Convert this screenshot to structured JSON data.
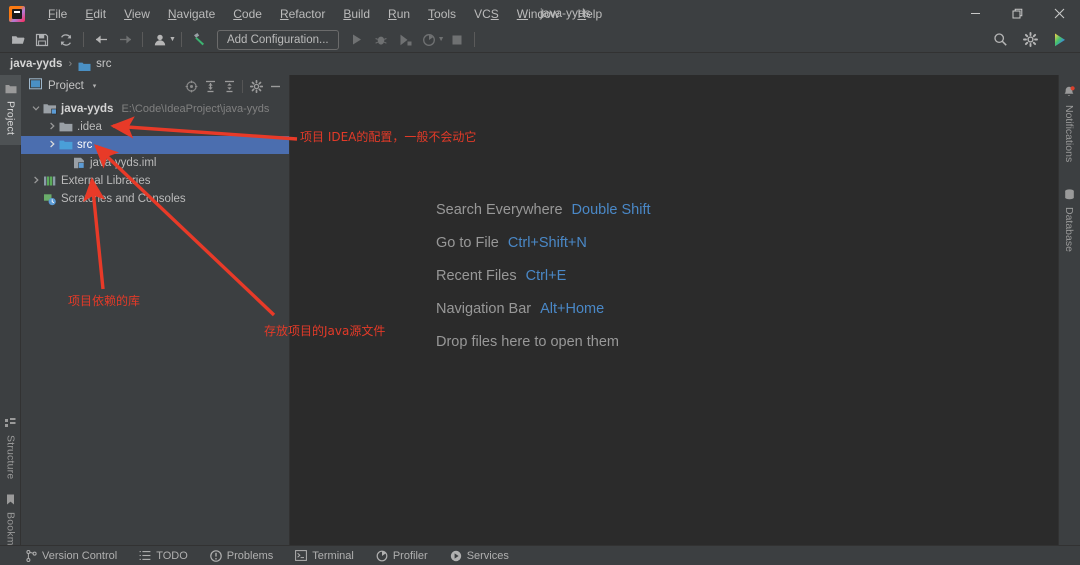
{
  "window": {
    "title": "java-yyds",
    "logo_icon": "intellij-idea-logo",
    "minimize_label": "─",
    "maximize_label": "❐",
    "close_label": "✕"
  },
  "menu": {
    "items": [
      {
        "label": "File",
        "mnemonic": "F"
      },
      {
        "label": "Edit",
        "mnemonic": "E"
      },
      {
        "label": "View",
        "mnemonic": "V"
      },
      {
        "label": "Navigate",
        "mnemonic": "N"
      },
      {
        "label": "Code",
        "mnemonic": "C"
      },
      {
        "label": "Refactor",
        "mnemonic": "R"
      },
      {
        "label": "Build",
        "mnemonic": "B"
      },
      {
        "label": "Run",
        "mnemonic": "R"
      },
      {
        "label": "Tools",
        "mnemonic": "T"
      },
      {
        "label": "VCS",
        "mnemonic": "S"
      },
      {
        "label": "Window",
        "mnemonic": "W"
      },
      {
        "label": "Help",
        "mnemonic": "H"
      }
    ]
  },
  "toolbar": {
    "open_icon": "open-folder-icon",
    "save_icon": "save-icon",
    "sync_icon": "sync-refresh-icon",
    "back_icon": "arrow-left-icon",
    "forward_icon": "arrow-right-icon",
    "profile_icon": "user-profile-icon",
    "build_icon": "hammer-build-icon",
    "add_configuration_label": "Add Configuration...",
    "run_icon": "run-play-icon",
    "debug_icon": "debug-bug-icon",
    "run_coverage_icon": "run-with-coverage-icon",
    "profiler_icon": "profiler-icon",
    "stop_icon": "stop-square-icon",
    "search_icon": "search-icon",
    "settings_icon": "gear-settings-icon",
    "ide_services_icon": "ide-services-icon"
  },
  "breadcrumb": {
    "project_label": "java-yyds",
    "separator": "›",
    "folder_icon": "folder-icon",
    "current_label": "src"
  },
  "left_stripe": {
    "project_label": "Project",
    "project_icon": "project-panel-icon",
    "structure_label": "Structure",
    "structure_icon": "structure-icon",
    "bookmarks_label": "Bookmarks",
    "bookmarks_icon": "bookmark-icon"
  },
  "right_stripe": {
    "notifications_label": "Notifications",
    "notifications_icon": "bell-notification-icon",
    "database_label": "Database",
    "database_icon": "database-icon"
  },
  "project_panel": {
    "title": "Project",
    "title_icon": "project-view-icon",
    "dropdown_caret": "▾",
    "tools": {
      "locate_icon": "scroll-from-source-icon",
      "expand_all_icon": "expand-all-icon",
      "collapse_all_icon": "collapse-all-icon",
      "settings_icon": "gear-settings-icon",
      "hide_icon": "hide-panel-icon"
    },
    "tree": [
      {
        "label": "java-yyds",
        "path": "E:\\Code\\IdeaProject\\java-yyds",
        "icon": "project-module-icon",
        "toggle": "⌄",
        "expanded": true,
        "indent": 0,
        "selected": false,
        "bold": true
      },
      {
        "label": ".idea",
        "path": "",
        "icon": "folder-icon",
        "toggle": "›",
        "expanded": false,
        "indent": 1,
        "selected": false,
        "bold": false
      },
      {
        "label": "src",
        "path": "",
        "icon": "source-folder-icon",
        "toggle": "›",
        "expanded": false,
        "indent": 1,
        "selected": true,
        "bold": false
      },
      {
        "label": "java-yyds.iml",
        "path": "",
        "icon": "iml-module-file-icon",
        "toggle": "",
        "expanded": false,
        "indent": 2,
        "selected": false,
        "bold": false
      },
      {
        "label": "External Libraries",
        "path": "",
        "icon": "external-libraries-icon",
        "toggle": "›",
        "expanded": false,
        "indent": 0,
        "selected": false,
        "bold": false
      },
      {
        "label": "Scratches and Consoles",
        "path": "",
        "icon": "scratches-consoles-icon",
        "toggle": "",
        "expanded": false,
        "indent": 0,
        "selected": false,
        "bold": false
      }
    ]
  },
  "editor": {
    "hints": [
      {
        "label": "Search Everywhere",
        "key": "Double Shift"
      },
      {
        "label": "Go to File",
        "key": "Ctrl+Shift+N"
      },
      {
        "label": "Recent Files",
        "key": "Ctrl+E"
      },
      {
        "label": "Navigation Bar",
        "key": "Alt+Home"
      },
      {
        "label": "Drop files here to open them",
        "key": ""
      }
    ]
  },
  "status_bar": {
    "items": [
      {
        "label": "Version Control",
        "icon": "version-control-branch-icon"
      },
      {
        "label": "TODO",
        "icon": "todo-list-icon"
      },
      {
        "label": "Problems",
        "icon": "problems-warning-icon"
      },
      {
        "label": "Terminal",
        "icon": "terminal-icon"
      },
      {
        "label": "Profiler",
        "icon": "profiler-icon"
      },
      {
        "label": "Services",
        "icon": "services-icon"
      }
    ]
  },
  "annotations": {
    "color": "#e33a28",
    "items": [
      {
        "text": "项目 IDEA的配置，一般不会动它",
        "target": ".idea"
      },
      {
        "text": "项目依赖的库",
        "target": "External Libraries"
      },
      {
        "text": "存放项目的Java源文件",
        "target": "src"
      }
    ]
  },
  "colors": {
    "chrome": "#3c3f41",
    "editor_bg": "#2b2b2b",
    "selection": "#4b6eaf",
    "accent_link": "#4a88c7",
    "annotation_red": "#e33a28",
    "text": "#bbbbbb"
  }
}
